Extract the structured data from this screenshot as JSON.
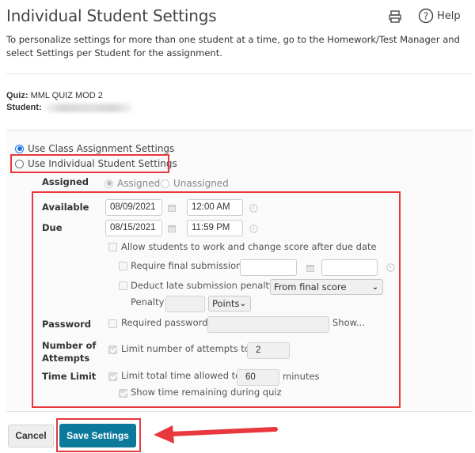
{
  "header": {
    "title": "Individual Student Settings",
    "print_icon": "printer-icon",
    "help_label": "Help",
    "help_icon": "question-circle-icon"
  },
  "intro": "To personalize settings for more than one student at a time, go to the Homework/Test Manager and select Settings per Student for the assignment.",
  "meta": {
    "quiz_label": "Quiz:",
    "quiz_value": "MML QUIZ MOD 2",
    "student_label": "Student:",
    "student_value": ""
  },
  "mode": {
    "options": [
      {
        "label": "Use Class Assignment Settings",
        "checked": true
      },
      {
        "label": "Use Individual Student Settings",
        "checked": false
      }
    ]
  },
  "settings": {
    "assigned": {
      "label": "Assigned",
      "options": [
        {
          "label": "Assigned",
          "checked": true
        },
        {
          "label": "Unassigned",
          "checked": false
        }
      ]
    },
    "available": {
      "label": "Available",
      "date": "08/09/2021",
      "time": "12:00 AM"
    },
    "due": {
      "label": "Due",
      "date": "08/15/2021",
      "time": "11:59 PM"
    },
    "allow_late": {
      "label": "Allow students to work and change score after due date",
      "checked": false
    },
    "require_final": {
      "label": "Require final submission",
      "checked": false,
      "date": "",
      "time": ""
    },
    "deduct_penalty": {
      "label": "Deduct late submission penalty",
      "checked": false,
      "mode": "From final score"
    },
    "penalty": {
      "label": "Penalty",
      "value": "",
      "unit": "Points"
    },
    "password": {
      "label": "Password",
      "checkbox_label": "Required password",
      "checked": false,
      "value": "",
      "show_label": "Show..."
    },
    "attempts": {
      "label_line1": "Number of",
      "label_line2": "Attempts",
      "checkbox_label": "Limit number of attempts to",
      "checked": true,
      "value": "2"
    },
    "time_limit": {
      "label": "Time Limit",
      "checkbox_label": "Limit total time allowed to",
      "checked": true,
      "value": "60",
      "unit_label": "minutes",
      "show_remaining": {
        "label": "Show time remaining during quiz",
        "checked": true
      }
    }
  },
  "footer": {
    "cancel_label": "Cancel",
    "save_label": "Save Settings"
  },
  "colors": {
    "annotation_red": "#e8383d",
    "primary_button": "#0b7a9a",
    "radio_selected": "#1a73e8"
  }
}
